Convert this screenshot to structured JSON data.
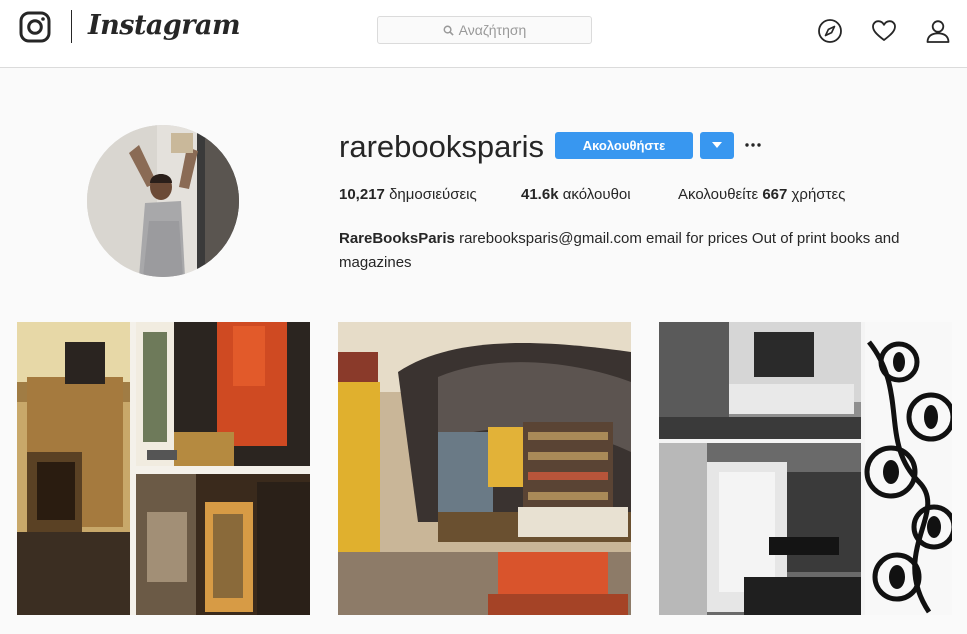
{
  "nav": {
    "brand": "Instagram",
    "search_placeholder": "Αναζήτηση",
    "icons": [
      "instagram-glyph-icon",
      "search-icon",
      "compass-icon",
      "heart-icon",
      "user-icon"
    ]
  },
  "profile": {
    "username": "rarebooksparis",
    "follow_label": "Ακολουθήστε",
    "dropdown_icon": "caret-down-icon",
    "more_icon": "more-dots-icon",
    "stats": {
      "posts_count": "10,217",
      "posts_label": "δημοσιεύσεις",
      "followers_count": "41.6k",
      "followers_label": "ακόλουθοι",
      "following_prefix": "Ακολουθείτε",
      "following_count": "667",
      "following_suffix": "χρήστες"
    },
    "bio_name": "RareBooksParis",
    "bio_text": "rarebooksparis@gmail.com email for prices Out of print books and magazines"
  },
  "posts": [
    {
      "subject": "collage-interior-fireplace-orange-wall"
    },
    {
      "subject": "interior-curved-ceiling-bookshelf"
    },
    {
      "subject": "collage-black-white-interior-floral-pattern"
    }
  ],
  "colors": {
    "accent": "#3897f0",
    "text": "#262626",
    "background": "#fafafa",
    "border": "#dbdbdb"
  }
}
